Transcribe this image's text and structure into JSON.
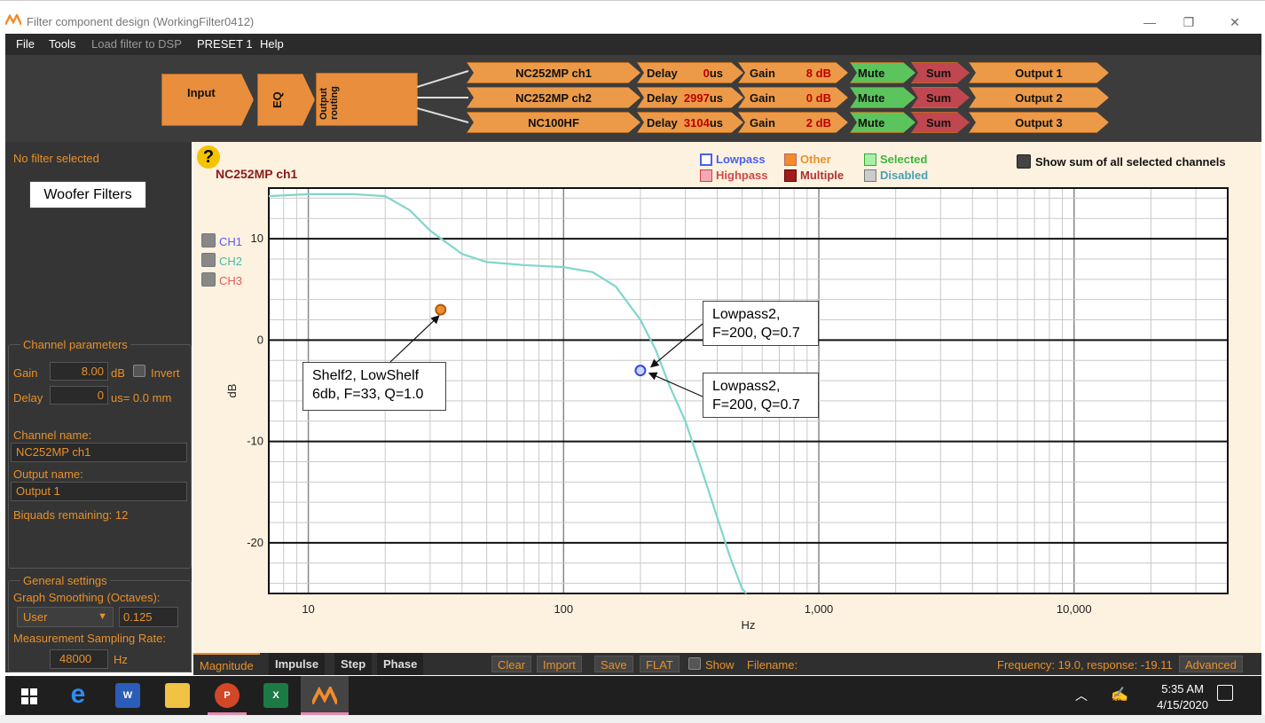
{
  "window": {
    "title": "Filter component design (WorkingFilter0412)",
    "min": "—",
    "max": "❐",
    "close": "✕"
  },
  "menu": {
    "file": "File",
    "tools": "Tools",
    "load": "Load filter to DSP",
    "preset": "PRESET 1",
    "help": "Help"
  },
  "routing": {
    "input": "Input",
    "eq": "EQ",
    "output_routing": "Output routing",
    "delay_label": "Delay",
    "gain_label": "Gain",
    "mute": "Mute",
    "sum": "Sum",
    "channels": [
      {
        "name": "NC252MP ch1",
        "delay": "0",
        "delay_unit": "us",
        "gain": "8",
        "gain_unit": "dB",
        "output": "Output 1"
      },
      {
        "name": "NC252MP ch2",
        "delay": "2997",
        "delay_unit": "us",
        "gain": "0",
        "gain_unit": "dB",
        "output": "Output 2"
      },
      {
        "name": "NC100HF",
        "delay": "3104",
        "delay_unit": "us",
        "gain": "2",
        "gain_unit": "dB",
        "output": "Output 3"
      }
    ]
  },
  "left": {
    "no_filter": "No filter selected",
    "woofer_label": "Woofer Filters",
    "channel_params": "Channel parameters",
    "gain_label": "Gain",
    "gain_value": "8.00",
    "gain_unit": "dB",
    "invert": "Invert",
    "delay_label": "Delay",
    "delay_value": "0",
    "delay_unit": "us= 0.0 mm",
    "channel_name_label": "Channel name:",
    "channel_name": "NC252MP ch1",
    "output_name_label": "Output name:",
    "output_name": "Output 1",
    "biquads": "Biquads remaining: 12",
    "general_settings": "General settings",
    "smoothing_label": "Graph Smoothing (Octaves):",
    "smoothing_mode": "User",
    "smoothing_value": "0.125",
    "sampling_label": "Measurement Sampling Rate:",
    "sampling_value": "48000",
    "sampling_unit": "Hz"
  },
  "graph": {
    "help": "?",
    "channel_title": "NC252MP ch1",
    "legend": {
      "lowpass": "Lowpass",
      "highpass": "Highpass",
      "other": "Other",
      "multiple": "Multiple",
      "selected": "Selected",
      "disabled": "Disabled",
      "show_sum": "Show sum of all selected channels"
    },
    "channels": [
      "CH1",
      "CH2",
      "CH3"
    ],
    "ylabel": "dB",
    "xlabel": "Hz",
    "yticks": [
      "10",
      "0",
      "-10",
      "-20"
    ],
    "xticks": [
      "10",
      "100",
      "1,000",
      "10,000"
    ],
    "colors": {
      "curve": "#7fd6cc",
      "ch1": "#5b5bff",
      "ch2": "#48b8a8",
      "ch3": "#e45a5a",
      "accent": "#e8902a"
    }
  },
  "chart_data": {
    "type": "line",
    "xlabel": "Hz",
    "ylabel": "dB",
    "xscale": "log",
    "xlim": [
      7,
      40000
    ],
    "ylim": [
      -25,
      15
    ],
    "series": [
      {
        "name": "NC252MP ch1",
        "x": [
          7,
          10,
          15,
          20,
          25,
          30,
          40,
          50,
          70,
          100,
          130,
          160,
          200,
          230,
          260,
          300,
          350,
          400,
          450,
          500,
          520
        ],
        "y": [
          14.2,
          14.4,
          14.4,
          14.2,
          12.8,
          10.8,
          8.5,
          7.7,
          7.4,
          7.2,
          6.7,
          5.3,
          2.0,
          -1.0,
          -4.5,
          -8.0,
          -13.0,
          -17.5,
          -21.5,
          -24.5,
          -25.0
        ]
      }
    ],
    "points": [
      {
        "label": "Shelf2",
        "x": 33,
        "y": 3.0,
        "kind": "other"
      },
      {
        "label": "Lowpass2",
        "x": 200,
        "y": -3.0,
        "kind": "lowpass"
      }
    ]
  },
  "callouts": {
    "shelf_line1": "Shelf2, LowShelf",
    "shelf_line2": "6db, F=33, Q=1.0",
    "lp1_line1": "Lowpass2,",
    "lp1_line2": "F=200, Q=0.7",
    "lp2_line1": "Lowpass2,",
    "lp2_line2": "F=200, Q=0.7"
  },
  "bottom": {
    "tabs": [
      "Magnitude",
      "Impulse",
      "Step",
      "Phase"
    ],
    "clear": "Clear",
    "import": "Import",
    "save": "Save",
    "flat": "FLAT",
    "show": "Show",
    "filename": "Filename:",
    "status": "Frequency: 19.0, response: -19.11",
    "advanced": "Advanced"
  },
  "taskbar": {
    "time": "5:35 AM",
    "date": "4/15/2020"
  }
}
